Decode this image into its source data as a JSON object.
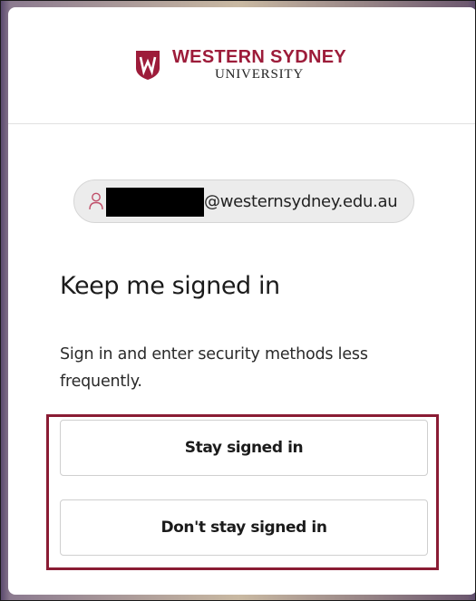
{
  "brand": {
    "name_line1": "WESTERN SYDNEY",
    "name_line2": "UNIVERSITY",
    "shield_letter": "W",
    "primary_color": "#9d1c3a"
  },
  "account": {
    "icon": "person-icon",
    "email_domain": "@westernsydney.edu.au",
    "username_redacted": true
  },
  "main": {
    "title": "Keep me signed in",
    "description": "Sign in and enter security methods less frequently."
  },
  "buttons": {
    "stay_label": "Stay signed in",
    "dont_stay_label": "Don't stay signed in"
  },
  "annotation": {
    "highlight_color": "#8a1c34"
  }
}
